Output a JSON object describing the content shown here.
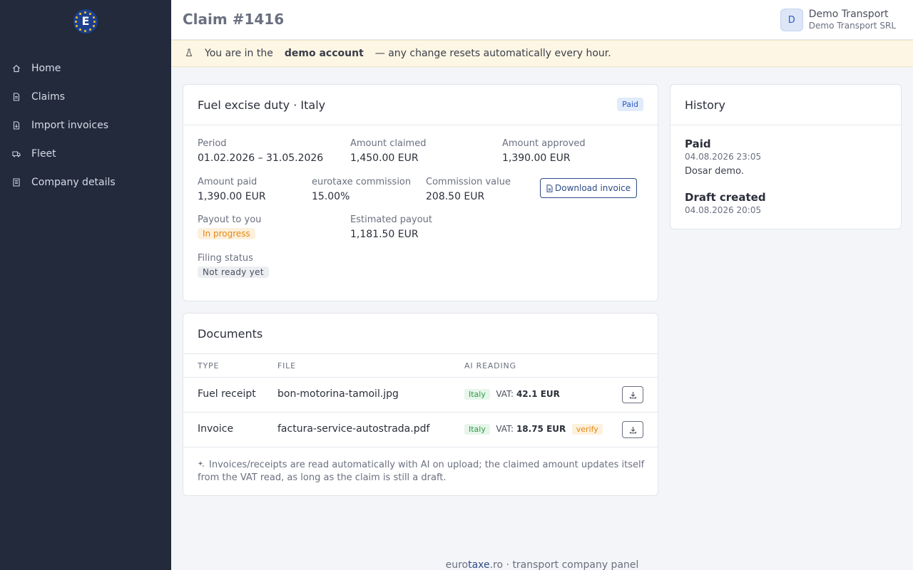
{
  "sidebar": {
    "logo_letter": "E",
    "items": [
      {
        "label": "Home",
        "icon": "home-icon"
      },
      {
        "label": "Claims",
        "icon": "document-icon"
      },
      {
        "label": "Import invoices",
        "icon": "import-file-icon"
      },
      {
        "label": "Fleet",
        "icon": "truck-icon"
      },
      {
        "label": "Company details",
        "icon": "building-icon"
      }
    ]
  },
  "header": {
    "title": "Claim #1416",
    "avatar_initial": "D",
    "user_name": "Demo Transport",
    "user_company": "Demo Transport SRL"
  },
  "banner": {
    "icon": "flask-icon",
    "text_before": "You are in the",
    "text_bold": "demo account",
    "text_after": "— any change resets automatically every hour."
  },
  "claim": {
    "title": "Fuel excise duty · Italy",
    "status_badge": "Paid",
    "period_label": "Period",
    "period_value": "01.02.2026 – 31.05.2026",
    "claimed_label": "Amount claimed",
    "claimed_value": "1,450.00 EUR",
    "approved_label": "Amount approved",
    "approved_value": "1,390.00 EUR",
    "paid_label": "Amount paid",
    "paid_value": "1,390.00 EUR",
    "commission_label": "eurotaxe commission",
    "commission_value": "15.00%",
    "commission_amount_label": "Commission value",
    "commission_amount_value": "208.50 EUR",
    "download_invoice": "Download invoice",
    "payout_label": "Payout to you",
    "payout_status": "In progress",
    "estimated_label": "Estimated payout",
    "estimated_value": "1,181.50 EUR",
    "filing_label": "Filing status",
    "filing_status": "Not ready yet"
  },
  "documents": {
    "title": "Documents",
    "columns": [
      "TYPE",
      "FILE",
      "AI READING"
    ],
    "rows": [
      {
        "type": "Fuel receipt",
        "file": "bon-motorina-tamoil.jpg",
        "country": "Italy",
        "vat_label": "VAT:",
        "vat_value": "42.1 EUR",
        "flag": ""
      },
      {
        "type": "Invoice",
        "file": "factura-service-autostrada.pdf",
        "country": "Italy",
        "vat_label": "VAT:",
        "vat_value": "18.75 EUR",
        "flag": "verify"
      }
    ],
    "note": "Invoices/receipts are read automatically with AI on upload; the claimed amount updates itself from the VAT read, as long as the claim is still a draft."
  },
  "history": {
    "title": "History",
    "items": [
      {
        "title": "Paid",
        "date": "04.08.2026 23:05",
        "note": "Dosar demo."
      },
      {
        "title": "Draft created",
        "date": "04.08.2026 20:05",
        "note": ""
      }
    ]
  },
  "footer": {
    "brand_a": "euro",
    "brand_b": "taxe",
    "rest": ".ro · transport company panel"
  },
  "colors": {
    "sidebar_bg": "#222a3c",
    "accent": "#2d4a86",
    "paid_badge": "#2d5bc4",
    "banner_bg": "#fdf6e4"
  }
}
